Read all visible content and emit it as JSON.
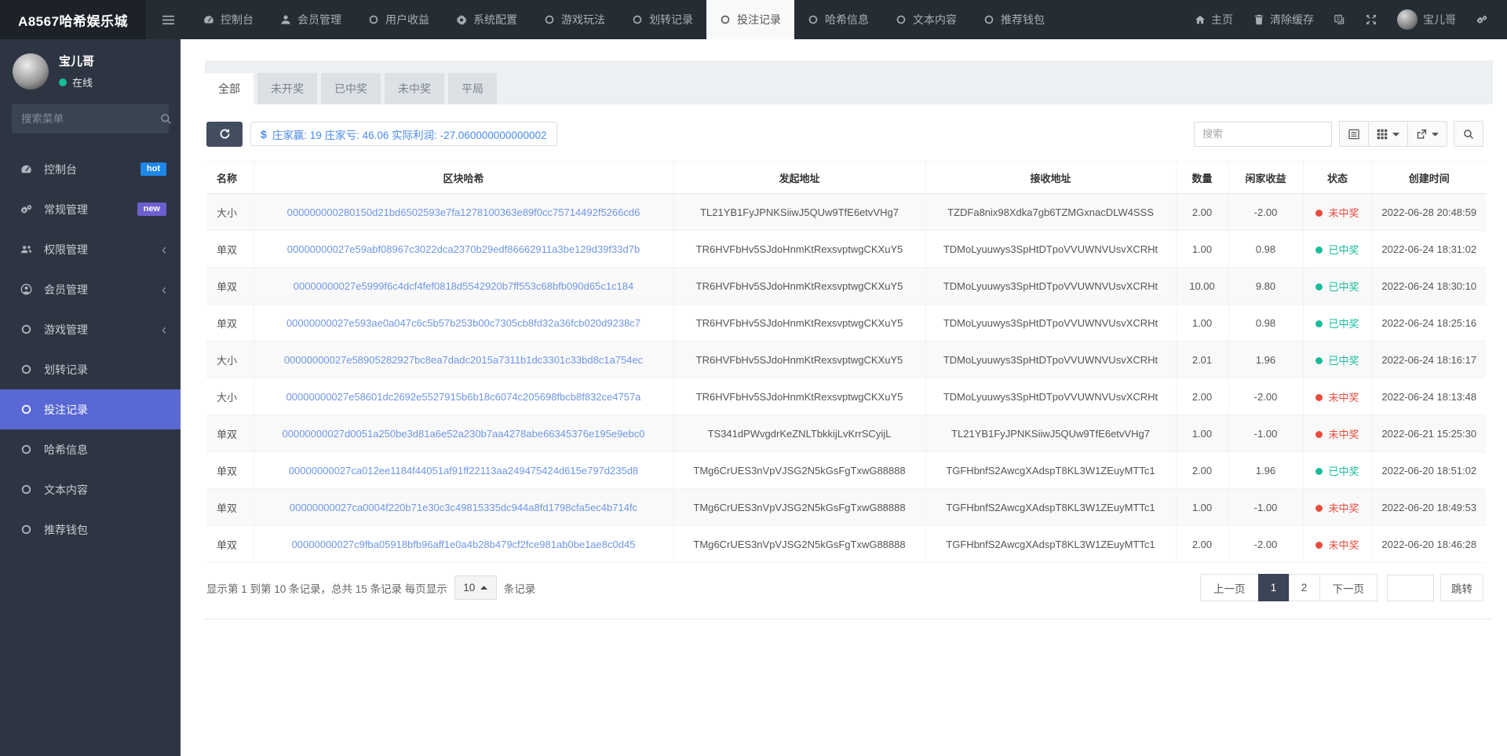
{
  "navbar": {
    "brand": "A8567哈希娱乐城",
    "items": [
      {
        "label": "控制台",
        "icon": "tachometer",
        "active": false
      },
      {
        "label": "会员管理",
        "icon": "user",
        "active": false
      },
      {
        "label": "用户收益",
        "icon": "circle",
        "active": false
      },
      {
        "label": "系统配置",
        "icon": "gear",
        "active": false
      },
      {
        "label": "游戏玩法",
        "icon": "circle",
        "active": false
      },
      {
        "label": "划转记录",
        "icon": "circle",
        "active": false
      },
      {
        "label": "投注记录",
        "icon": "circle",
        "active": true
      },
      {
        "label": "哈希信息",
        "icon": "circle",
        "active": false
      },
      {
        "label": "文本内容",
        "icon": "circle",
        "active": false
      },
      {
        "label": "推荐钱包",
        "icon": "circle",
        "active": false
      }
    ],
    "home_label": "主页",
    "clear_cache_label": "清除缓存",
    "username": "宝儿哥"
  },
  "sidebar": {
    "username": "宝儿哥",
    "online_status": "在线",
    "search_placeholder": "搜索菜单",
    "menu": [
      {
        "label": "控制台",
        "icon": "tachometer",
        "badge": "hot"
      },
      {
        "label": "常规管理",
        "icon": "cogs",
        "badge": "new"
      },
      {
        "label": "权限管理",
        "icon": "users",
        "arrow": true
      },
      {
        "label": "会员管理",
        "icon": "usercircle",
        "arrow": true
      },
      {
        "label": "游戏管理",
        "icon": "circle",
        "arrow": true
      },
      {
        "label": "划转记录",
        "icon": "circle"
      },
      {
        "label": "投注记录",
        "icon": "circle",
        "active": true
      },
      {
        "label": "哈希信息",
        "icon": "circle"
      },
      {
        "label": "文本内容",
        "icon": "circle"
      },
      {
        "label": "推荐钱包",
        "icon": "circle"
      }
    ]
  },
  "tabs": {
    "items": [
      "全部",
      "未开奖",
      "已中奖",
      "未中奖",
      "平局"
    ],
    "active": 0
  },
  "toolbar": {
    "stats_text": "庄家赢: 19 庄家亏: 46.06 实际利润: -27.060000000000002",
    "search_placeholder": "搜索"
  },
  "table": {
    "columns": [
      "名称",
      "区块哈希",
      "发起地址",
      "接收地址",
      "数量",
      "闲家收益",
      "状态",
      "创建时间"
    ],
    "rows": [
      {
        "name": "大小",
        "hash": "000000000280150d21bd6502593e7fa1278100363e89f0cc75714492f5266cd6",
        "from": "TL21YB1FyJPNKSiiwJ5QUw9TfE6etvVHg7",
        "to": "TZDFa8nix98Xdka7gb6TZMGxnacDLW4SSS",
        "amount": "2.00",
        "profit": "-2.00",
        "status": "未中奖",
        "status_type": "lose",
        "time": "2022-06-28 20:48:59"
      },
      {
        "name": "单双",
        "hash": "00000000027e59abf08967c3022dca2370b29edf86662911a3be129d39f33d7b",
        "from": "TR6HVFbHv5SJdoHnmKtRexsvptwgCKXuY5",
        "to": "TDMoLyuuwys3SpHtDTpoVVUWNVUsvXCRHt",
        "amount": "1.00",
        "profit": "0.98",
        "status": "已中奖",
        "status_type": "win",
        "time": "2022-06-24 18:31:02"
      },
      {
        "name": "单双",
        "hash": "00000000027e5999f6c4dcf4fef0818d5542920b7ff553c68bfb090d65c1c184",
        "from": "TR6HVFbHv5SJdoHnmKtRexsvptwgCKXuY5",
        "to": "TDMoLyuuwys3SpHtDTpoVVUWNVUsvXCRHt",
        "amount": "10.00",
        "profit": "9.80",
        "status": "已中奖",
        "status_type": "win",
        "time": "2022-06-24 18:30:10"
      },
      {
        "name": "单双",
        "hash": "00000000027e593ae0a047c6c5b57b253b00c7305cb8fd32a36fcb020d9238c7",
        "from": "TR6HVFbHv5SJdoHnmKtRexsvptwgCKXuY5",
        "to": "TDMoLyuuwys3SpHtDTpoVVUWNVUsvXCRHt",
        "amount": "1.00",
        "profit": "0.98",
        "status": "已中奖",
        "status_type": "win",
        "time": "2022-06-24 18:25:16"
      },
      {
        "name": "大小",
        "hash": "00000000027e58905282927bc8ea7dadc2015a7311b1dc3301c33bd8c1a754ec",
        "from": "TR6HVFbHv5SJdoHnmKtRexsvptwgCKXuY5",
        "to": "TDMoLyuuwys3SpHtDTpoVVUWNVUsvXCRHt",
        "amount": "2.01",
        "profit": "1.96",
        "status": "已中奖",
        "status_type": "win",
        "time": "2022-06-24 18:16:17"
      },
      {
        "name": "大小",
        "hash": "00000000027e58601dc2692e5527915b6b18c6074c205698fbcb8f832ce4757a",
        "from": "TR6HVFbHv5SJdoHnmKtRexsvptwgCKXuY5",
        "to": "TDMoLyuuwys3SpHtDTpoVVUWNVUsvXCRHt",
        "amount": "2.00",
        "profit": "-2.00",
        "status": "未中奖",
        "status_type": "lose",
        "time": "2022-06-24 18:13:48"
      },
      {
        "name": "单双",
        "hash": "00000000027d0051a250be3d81a6e52a230b7aa4278abe66345376e195e9ebc0",
        "from": "TS341dPWvgdrKeZNLTbkkijLvKrrSCyijL",
        "to": "TL21YB1FyJPNKSiiwJ5QUw9TfE6etvVHg7",
        "amount": "1.00",
        "profit": "-1.00",
        "status": "未中奖",
        "status_type": "lose",
        "time": "2022-06-21 15:25:30"
      },
      {
        "name": "单双",
        "hash": "00000000027ca012ee1184f44051af91ff22113aa249475424d615e797d235d8",
        "from": "TMg6CrUES3nVpVJSG2N5kGsFgTxwG88888",
        "to": "TGFHbnfS2AwcgXAdspT8KL3W1ZEuyMTTc1",
        "amount": "2.00",
        "profit": "1.96",
        "status": "已中奖",
        "status_type": "win",
        "time": "2022-06-20 18:51:02"
      },
      {
        "name": "单双",
        "hash": "00000000027ca0004f220b71e30c3c49815335dc944a8fd1798cfa5ec4b714fc",
        "from": "TMg6CrUES3nVpVJSG2N5kGsFgTxwG88888",
        "to": "TGFHbnfS2AwcgXAdspT8KL3W1ZEuyMTTc1",
        "amount": "1.00",
        "profit": "-1.00",
        "status": "未中奖",
        "status_type": "lose",
        "time": "2022-06-20 18:49:53"
      },
      {
        "name": "单双",
        "hash": "00000000027c9fba05918bfb96aff1e0a4b28b479cf2fce981ab0be1ae8c0d45",
        "from": "TMg6CrUES3nVpVJSG2N5kGsFgTxwG88888",
        "to": "TGFHbnfS2AwcgXAdspT8KL3W1ZEuyMTTc1",
        "amount": "2.00",
        "profit": "-2.00",
        "status": "未中奖",
        "status_type": "lose",
        "time": "2022-06-20 18:46:28"
      }
    ]
  },
  "pagination": {
    "info_prefix": "显示第 1 到第 10 条记录，总共 15 条记录 每页显示",
    "per_page": "10",
    "info_suffix": "条记录",
    "prev": "上一页",
    "pages": [
      "1",
      "2"
    ],
    "active_page": "1",
    "next": "下一页",
    "jump_label": "跳转"
  },
  "colors": {
    "sidebar_active": "#5968d4",
    "badge_hot": "#1e87e8",
    "badge_new": "#6e5fd0",
    "status_win": "#18bc9c",
    "status_lose": "#e74c3c",
    "hash_link": "#6f96e3",
    "stats_text": "#4a8bea",
    "online_dot": "#1abc9c",
    "refresh_button": "#424d5f",
    "active_page_bg": "#3c4457"
  }
}
